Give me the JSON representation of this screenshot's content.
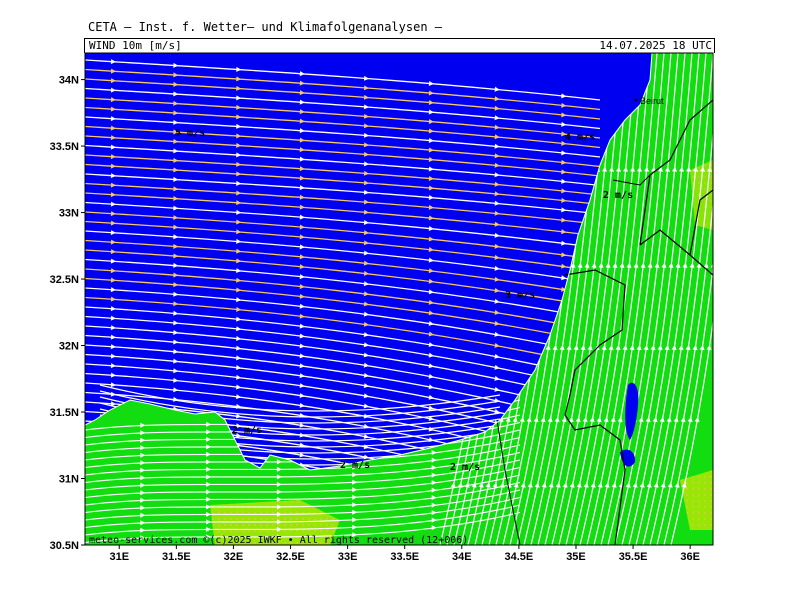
{
  "header": {
    "title": "CETA — Inst. f. Wetter— und Klimafolgenanalysen —",
    "field": "WIND 10m [m/s]",
    "valid_time": "14.07.2025 18 UTC"
  },
  "map": {
    "lon_labels": [
      "31E",
      "31.5E",
      "32E",
      "32.5E",
      "33E",
      "33.5E",
      "34E",
      "34.5E",
      "35E",
      "35.5E",
      "36E"
    ],
    "lon_values": [
      31,
      31.5,
      32,
      32.5,
      33,
      33.5,
      34,
      34.5,
      35,
      35.5,
      36
    ],
    "lat_labels": [
      "34N",
      "33.5N",
      "33N",
      "32.5N",
      "32N",
      "31.5N",
      "31N",
      "30.5N"
    ],
    "lat_values": [
      34,
      33.5,
      33,
      32.5,
      32,
      31.5,
      31,
      30.5
    ],
    "lon_range": [
      30.7,
      36.2
    ],
    "lat_range": [
      30.5,
      34.2
    ],
    "colors": {
      "sea": "#0000f0",
      "land": "#11dd11",
      "land_warm": "#b9e800",
      "stream_light": "#ffffff",
      "stream_fast": "#f5c86a",
      "border": "#000000"
    },
    "city": "Beirut",
    "speed_labels": [
      "5 m/s",
      "4 m/s",
      "2 m/s",
      "3 m/s",
      "2 m/s",
      "2 m/s",
      "2 m/s"
    ]
  },
  "footer": {
    "credit": "meteo-services.com  ©(c)2025 IWKF • All rights reserved (12+006)"
  }
}
